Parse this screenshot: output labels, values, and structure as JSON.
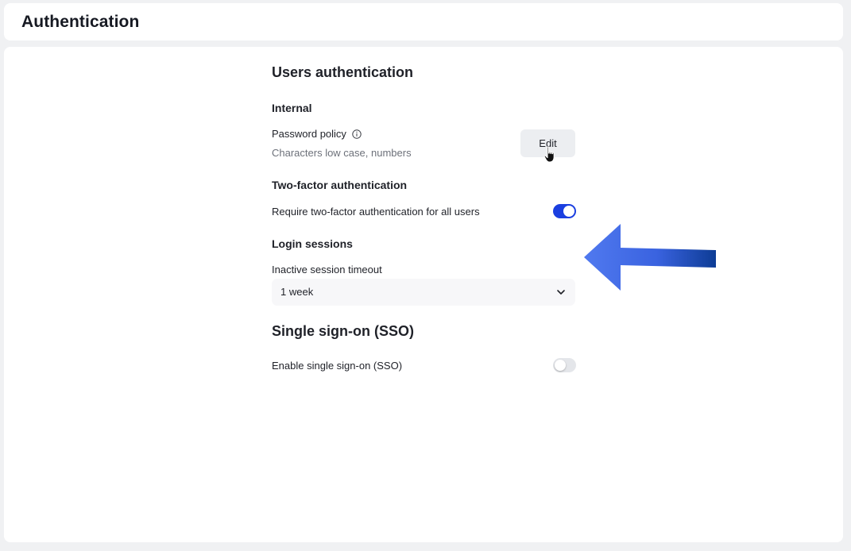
{
  "header": {
    "title": "Authentication"
  },
  "users_auth": {
    "title": "Users authentication",
    "internal": {
      "heading": "Internal",
      "password_policy_label": "Password policy",
      "password_policy_desc": "Characters low case, numbers",
      "edit_label": "Edit"
    },
    "two_factor": {
      "heading": "Two-factor authentication",
      "require_label": "Require two-factor authentication for all users",
      "enabled": true
    },
    "login_sessions": {
      "heading": "Login sessions",
      "timeout_label": "Inactive session timeout",
      "timeout_value": "1 week"
    }
  },
  "sso": {
    "title": "Single sign-on (SSO)",
    "enable_label": "Enable single sign-on (SSO)",
    "enabled": false
  },
  "colors": {
    "toggle_on": "#1b3fe0",
    "arrow_annotation": "#3f6be8"
  },
  "icons": [
    "info-icon",
    "pointer-cursor-icon",
    "chevron-down-icon",
    "annotation-arrow"
  ]
}
